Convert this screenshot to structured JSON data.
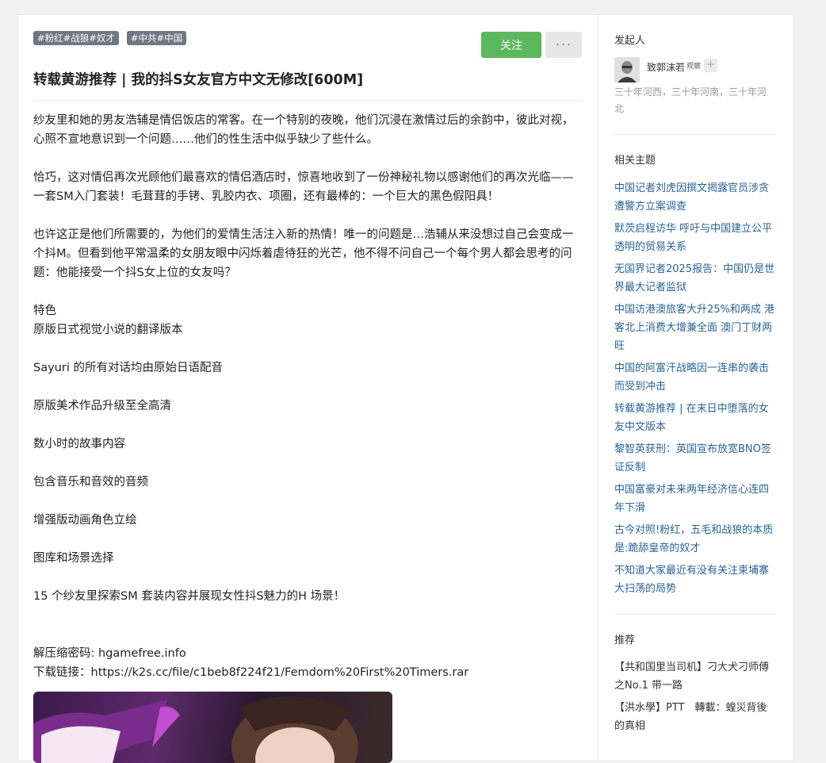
{
  "tags": [
    "#粉红#战狼#奴才",
    "#中共#中国"
  ],
  "follow_label": "关注",
  "more_label": "···",
  "title": "转载黄游推荐 | 我的抖S女友官方中文无修改[600M]",
  "body": {
    "p1": "纱友里和她的男友浩辅是情侣饭店的常客。在一个特别的夜晚，他们沉浸在激情过后的余韵中，彼此对视，心照不宣地意识到一个问题……他们的性生活中似乎缺少了些什么。",
    "p2": "恰巧，这对情侣再次光顾他们最喜欢的情侣酒店时，惊喜地收到了一份神秘礼物以感谢他们的再次光临——一套SM入门套装！毛茸茸的手铐、乳胶内衣、项圈，还有最棒的：一个巨大的黑色假阳具！",
    "p3": "也许这正是他们所需要的，为他们的爱情生活注入新的热情！唯一的问题是…浩辅从来没想过自己会变成一个抖M。但看到他平常温柔的女朋友眼中闪烁着虐待狂的光芒，他不得不问自己一个每个男人都会思考的问题：他能接受一个抖S女上位的女友吗？",
    "features_title": "特色",
    "features": [
      "原版日式视觉小说的翻译版本",
      "Sayuri 的所有对话均由原始日语配音",
      "原版美术作品升级至全高清",
      "数小时的故事内容",
      "包含音乐和音效的音频",
      "增强版动画角色立绘",
      "图库和场景选择",
      "15 个纱友里探索SM 套装内容并展现女性抖S魅力的H 场景！"
    ],
    "password": "解压缩密码: hgamefree.info",
    "download": "下载链接：https://k2s.cc/file/c1beb8f224f21/Femdom%20First%20Timers.rar"
  },
  "sidebar": {
    "starter_heading": "发起人",
    "user_name": "致郭沫若",
    "user_badge": "观察",
    "plus_label": "+",
    "user_bio": "三十年河西，三十年河南，三十年河北",
    "related_heading": "相关主题",
    "related": [
      "中国记者刘虎因撰文揭露官员涉贪遭警方立案调查",
      "默茨启程访华 呼吁与中国建立公平透明的贸易关系",
      "无国界记者2025报告：中国仍是世界最大记者监狱",
      "中国访港澳旅客大升25%和两成 港客北上消费大增兼全面 澳门丁财两旺",
      "中国的阿富汗战略因一连串的袭击而受到冲击",
      "转载黄游推荐 | 在末日中堕落的女友中文版本",
      "黎智英获刑：英国宣布放宽BNO签证反制",
      "中国富豪对未来两年经济信心连四年下滑",
      "古今对照!粉红，五毛和战狼的本质是:跪舔皇帝的奴才",
      "不知道大家最近有没有关注柬埔寨大扫荡的局势"
    ],
    "recommend_heading": "推荐",
    "recommend": [
      "【共和国里当司机】刁大犬刁师傅之No.1 带一路",
      "【洪水學】PTT　轉載：蝗災背後的真相"
    ]
  }
}
